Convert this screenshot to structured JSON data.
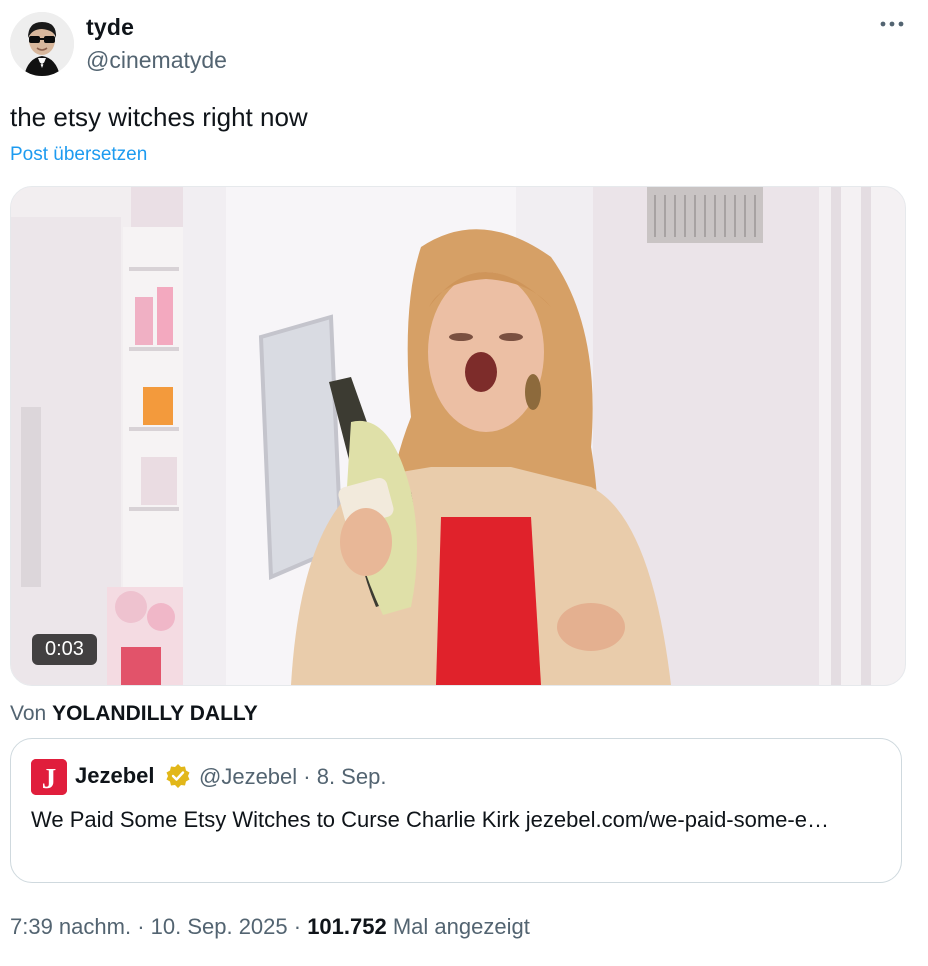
{
  "author": {
    "name": "tyde",
    "handle": "@cinematyde",
    "avatar_icon": "avatar-photo"
  },
  "more_icon": "more-options-icon",
  "post": {
    "text": "the etsy witches right now",
    "translate_label": "Post übersetzen"
  },
  "media": {
    "duration": "0:03",
    "source_prefix": "Von",
    "source_name": "YOLANDILLY DALLY"
  },
  "quote": {
    "logo_letter": "J",
    "name": "Jezebel",
    "verified_icon": "verified-badge-icon",
    "handle_date": "@Jezebel · 8. Sep.",
    "text": "We Paid Some Etsy Witches to Curse Charlie Kirk jezebel.com/we-paid-some-e…"
  },
  "footer": {
    "time_date": "7:39 nachm. · 10. Sep. 2025 · ",
    "views": "101.752",
    "views_label": " Mal angezeigt"
  },
  "colors": {
    "accent": "#1d9bf0",
    "secondary_text": "#536471",
    "jezebel_red": "#e01e3c",
    "verified_gold": "#e2b719"
  }
}
